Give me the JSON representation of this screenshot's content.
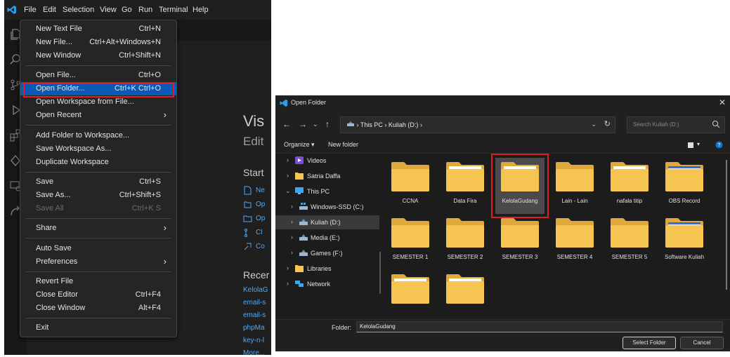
{
  "vscode": {
    "menubar": [
      "File",
      "Edit",
      "Selection",
      "View",
      "Go",
      "Run",
      "Terminal",
      "Help"
    ],
    "file_menu": [
      {
        "label": "New Text File",
        "shortcut": "Ctrl+N"
      },
      {
        "label": "New File...",
        "shortcut": "Ctrl+Alt+Windows+N"
      },
      {
        "label": "New Window",
        "shortcut": "Ctrl+Shift+N"
      },
      {
        "label": "Open File...",
        "shortcut": "Ctrl+O"
      },
      {
        "label": "Open Folder...",
        "shortcut": "Ctrl+K Ctrl+O"
      },
      {
        "label": "Open Workspace from File...",
        "shortcut": ""
      },
      {
        "label": "Open Recent",
        "shortcut": ""
      },
      {
        "label": "Add Folder to Workspace...",
        "shortcut": ""
      },
      {
        "label": "Save Workspace As...",
        "shortcut": ""
      },
      {
        "label": "Duplicate Workspace",
        "shortcut": ""
      },
      {
        "label": "Save",
        "shortcut": "Ctrl+S"
      },
      {
        "label": "Save As...",
        "shortcut": "Ctrl+Shift+S"
      },
      {
        "label": "Save All",
        "shortcut": "Ctrl+K S"
      },
      {
        "label": "Share",
        "shortcut": ""
      },
      {
        "label": "Auto Save",
        "shortcut": ""
      },
      {
        "label": "Preferences",
        "shortcut": ""
      },
      {
        "label": "Revert File",
        "shortcut": ""
      },
      {
        "label": "Close Editor",
        "shortcut": "Ctrl+F4"
      },
      {
        "label": "Close Window",
        "shortcut": "Alt+F4"
      },
      {
        "label": "Exit",
        "shortcut": ""
      }
    ],
    "welcome": {
      "title": "Vis",
      "subtitle": "Edit",
      "start_heading": "Start",
      "start_items": [
        "Ne",
        "Op",
        "Op",
        "Cl",
        "Co"
      ],
      "recent_heading": "Recer",
      "recent_items": [
        "KelolaG",
        "email-s",
        "email-s",
        "phpMa",
        "key-n-l",
        "More..."
      ]
    }
  },
  "dialog": {
    "title": "Open Folder",
    "close": "✕",
    "address": {
      "root": "This PC",
      "drive": "Kuliah (D:)",
      "separator": "›"
    },
    "search_placeholder": "Search Kuliah (D:)",
    "toolbar": {
      "organize": "Organize ▾",
      "new_folder": "New folder"
    },
    "nav_items": [
      {
        "label": "Videos",
        "chev": "›"
      },
      {
        "label": "Satria Daffa",
        "chev": "›"
      },
      {
        "label": "This PC",
        "chev": "⌄"
      },
      {
        "label": "Windows-SSD (C:)",
        "chev": "›"
      },
      {
        "label": "Kuliah (D:)",
        "chev": "›"
      },
      {
        "label": "Media (E:)",
        "chev": "›"
      },
      {
        "label": "Games (F:)",
        "chev": "›"
      },
      {
        "label": "Libraries",
        "chev": "›"
      },
      {
        "label": "Network",
        "chev": "›"
      }
    ],
    "folders": [
      "CCNA",
      "Data Fira",
      "KelolaGudang",
      "Lain - Lain",
      "nafala titip",
      "OBS Record",
      "SEMESTER 1",
      "SEMESTER 2",
      "SEMESTER 3",
      "SEMESTER 4",
      "SEMESTER 5",
      "Software Kuliah",
      "",
      ""
    ],
    "selected_folder": "KelolaGudang",
    "folder_label": "Folder:",
    "folder_value": "KelolaGudang",
    "select_button": "Select Folder",
    "cancel_button": "Cancel"
  },
  "colors": {
    "accent": "#0a59b5",
    "highlight": "#e01c24",
    "folder": "#f5c451"
  }
}
